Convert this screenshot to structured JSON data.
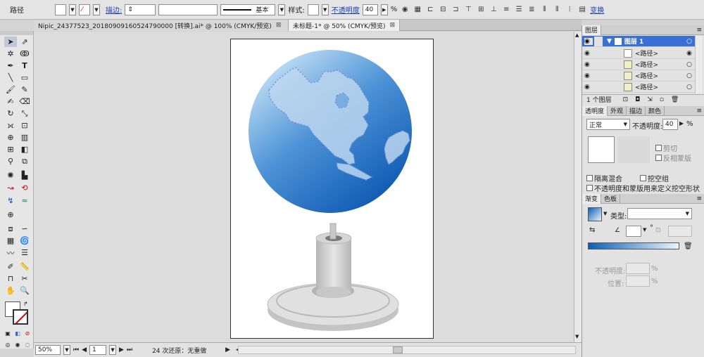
{
  "control_bar": {
    "object_type": "路径",
    "stroke_label": "描边:",
    "stroke_profile": "基本",
    "style_label": "样式:",
    "opacity_label": "不透明度",
    "opacity_value": "40",
    "opacity_unit": "%",
    "transform_label": "变换"
  },
  "tabs": [
    {
      "label": "Nipic_24377523_20180909160524790000  [转换].ai* @ 100% (CMYK/预览)",
      "close": "⊠"
    },
    {
      "label": "未标题-1* @ 50% (CMYK/预览)",
      "close": "⊠"
    }
  ],
  "status": {
    "zoom": "50%",
    "page": "1",
    "undo_text": "24 次还原：无重做"
  },
  "layers": {
    "title": "图层",
    "layer_name": "图层 1",
    "paths": [
      "<路径>",
      "<路径>",
      "<路径>",
      "<路径>"
    ],
    "count": "1 个图层"
  },
  "transparency": {
    "tabs": [
      "透明度",
      "外观",
      "描边",
      "颜色"
    ],
    "blend_mode": "正常",
    "opacity_label": "不透明度:",
    "opacity_value": "40",
    "opacity_unit": "%",
    "clip": "剪切",
    "invert_mask": "反相蒙版",
    "isolate_blend": "隔离混合",
    "knockout_group": "挖空组",
    "opacity_mask_define": "不透明度和蒙版用来定义挖空形状"
  },
  "gradient": {
    "tabs": [
      "渐变",
      "色板"
    ],
    "type_label": "类型:",
    "opacity_label": "不透明度:",
    "location_label": "位置:",
    "percent": "%",
    "degree": "°",
    "start_color": "#0b5fb8",
    "end_color": "#eaf4fb"
  },
  "colors": {
    "globe_light": "#c6e2f6",
    "globe_mid": "#4d93d6",
    "globe_dark": "#0b56b2",
    "stand_light": "#e2e2e2",
    "stand_mid": "#c9c9c9",
    "stand_dark": "#9e9e9e"
  }
}
